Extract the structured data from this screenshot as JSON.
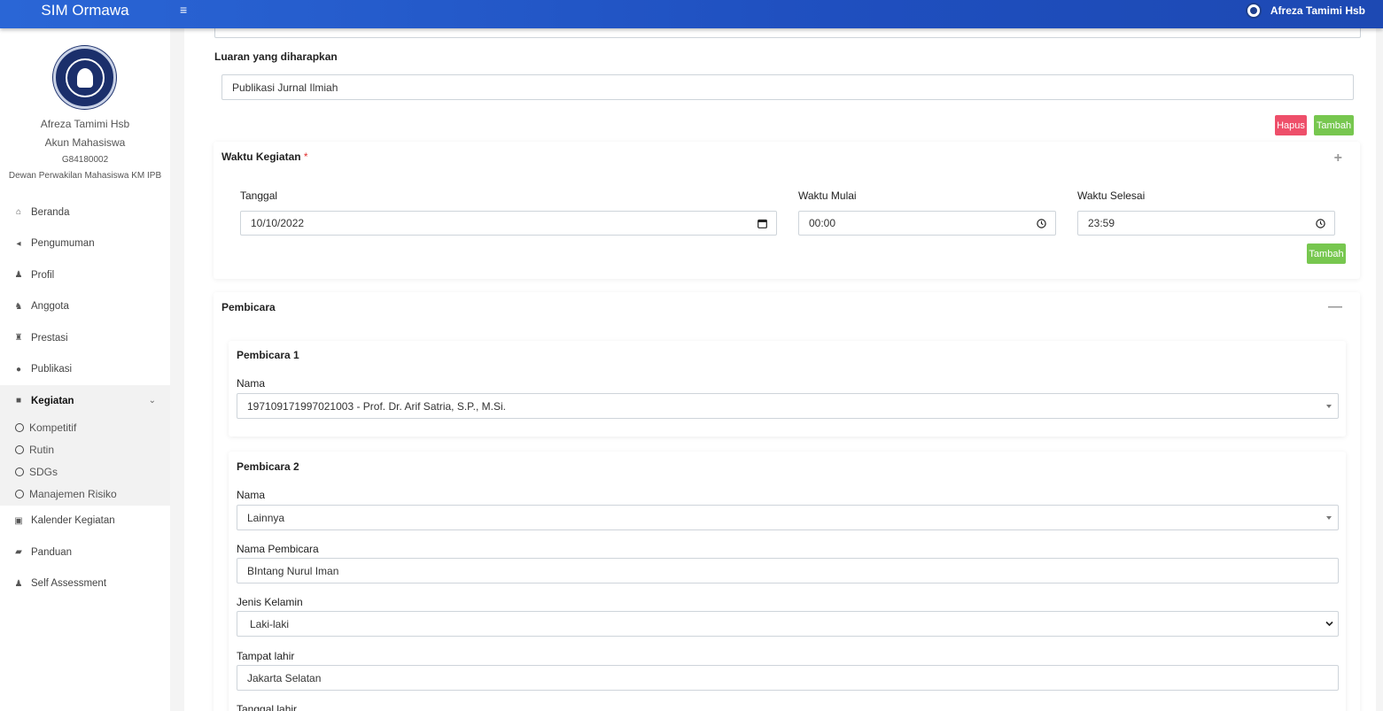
{
  "app": {
    "title": "SIM Ormawa",
    "menu_icon": "≡"
  },
  "topbar": {
    "user_name": "Afreza Tamimi Hsb"
  },
  "profile": {
    "name": "Afreza Tamimi Hsb",
    "role": "Akun Mahasiswa",
    "id": "G84180002",
    "organization": "Dewan Perwakilan Mahasiswa KM IPB"
  },
  "sidebar": {
    "items": [
      {
        "label": "Beranda",
        "icon": "home-icon",
        "glyph": "⌂"
      },
      {
        "label": "Pengumuman",
        "icon": "bullhorn-icon",
        "glyph": "◂"
      },
      {
        "label": "Profil",
        "icon": "user-icon",
        "glyph": "♟"
      },
      {
        "label": "Anggota",
        "icon": "users-icon",
        "glyph": "♞"
      },
      {
        "label": "Prestasi",
        "icon": "trophy-icon",
        "glyph": "♜"
      },
      {
        "label": "Publikasi",
        "icon": "comments-icon",
        "glyph": "●"
      },
      {
        "label": "Kegiatan",
        "icon": "folder-icon",
        "glyph": "■",
        "chevron": "⌄"
      },
      {
        "label": "Kalender Kegiatan",
        "icon": "calendar-icon",
        "glyph": "▣"
      },
      {
        "label": "Panduan",
        "icon": "book-icon",
        "glyph": "▰"
      },
      {
        "label": "Self Assessment",
        "icon": "user-icon",
        "glyph": "♟"
      }
    ],
    "sub_items": [
      "Kompetitif",
      "Rutin",
      "SDGs",
      "Manajemen Risiko"
    ]
  },
  "form": {
    "luaran": {
      "label": "Luaran yang diharapkan",
      "value": "Publikasi Jurnal Ilmiah"
    },
    "hapus_label": "Hapus",
    "tambah_label": "Tambah",
    "waktu": {
      "title": "Waktu Kegiatan",
      "required_mark": "*",
      "tool": "+",
      "tanggal_label": "Tanggal",
      "tanggal_value": "10/10/2022",
      "mulai_label": "Waktu Mulai",
      "mulai_value": "00:00",
      "selesai_label": "Waktu Selesai",
      "selesai_value": "23:59",
      "tambah_label": "Tambah"
    },
    "pembicara": {
      "title": "Pembicara",
      "tool": "—",
      "speaker1": {
        "title": "Pembicara 1",
        "nama_label": "Nama",
        "nama_value": "197109171997021003 - Prof. Dr. Arif Satria, S.P., M.Si."
      },
      "speaker2": {
        "title": "Pembicara 2",
        "nama_label": "Nama",
        "nama_value": "Lainnya",
        "nama_pembicara_label": "Nama Pembicara",
        "nama_pembicara_value": "BIntang Nurul Iman",
        "jenis_kelamin_label": "Jenis Kelamin",
        "jenis_kelamin_value": "Laki-laki",
        "tempat_lahir_label": "Tampat lahir",
        "tempat_lahir_value": "Jakarta Selatan",
        "tanggal_lahir_label": "Tanggal lahir"
      }
    }
  }
}
